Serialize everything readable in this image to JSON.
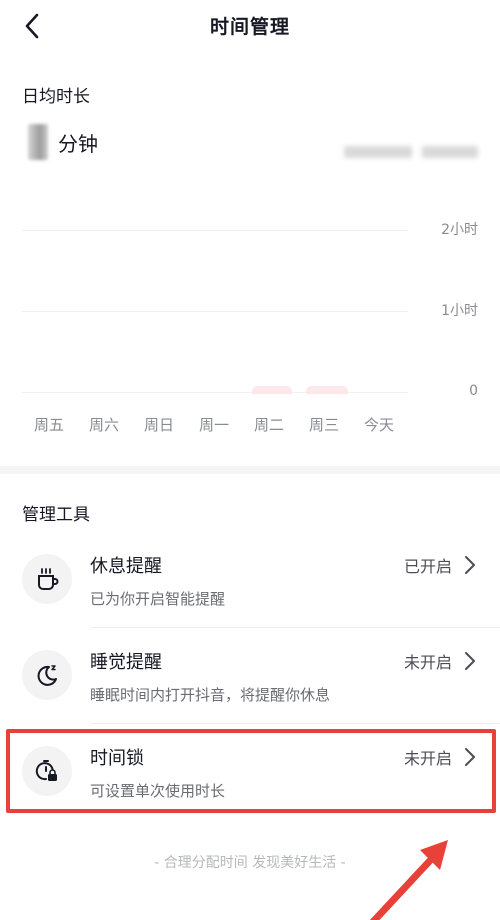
{
  "header": {
    "title": "时间管理"
  },
  "daily": {
    "label": "日均时长",
    "unit": "分钟"
  },
  "chart_data": {
    "type": "bar",
    "categories": [
      "周五",
      "周六",
      "周日",
      "周一",
      "周二",
      "周三",
      "今天"
    ],
    "y_ticks": [
      "2小时",
      "1小时",
      "0"
    ],
    "ylim": [
      0,
      2
    ],
    "grid": true
  },
  "tools": {
    "title": "管理工具",
    "items": [
      {
        "title": "休息提醒",
        "subtitle": "已为你开启智能提醒",
        "status": "已开启",
        "icon": "cup-icon"
      },
      {
        "title": "睡觉提醒",
        "subtitle": "睡眠时间内打开抖音，将提醒你休息",
        "status": "未开启",
        "icon": "moon-icon"
      },
      {
        "title": "时间锁",
        "subtitle": "可设置单次使用时长",
        "status": "未开启",
        "icon": "timer-lock-icon"
      }
    ]
  },
  "footer": {
    "text": "- 合理分配时间 发现美好生活 -"
  },
  "colors": {
    "highlight": "#e8413a",
    "accent_bar": "#fde3e6"
  }
}
